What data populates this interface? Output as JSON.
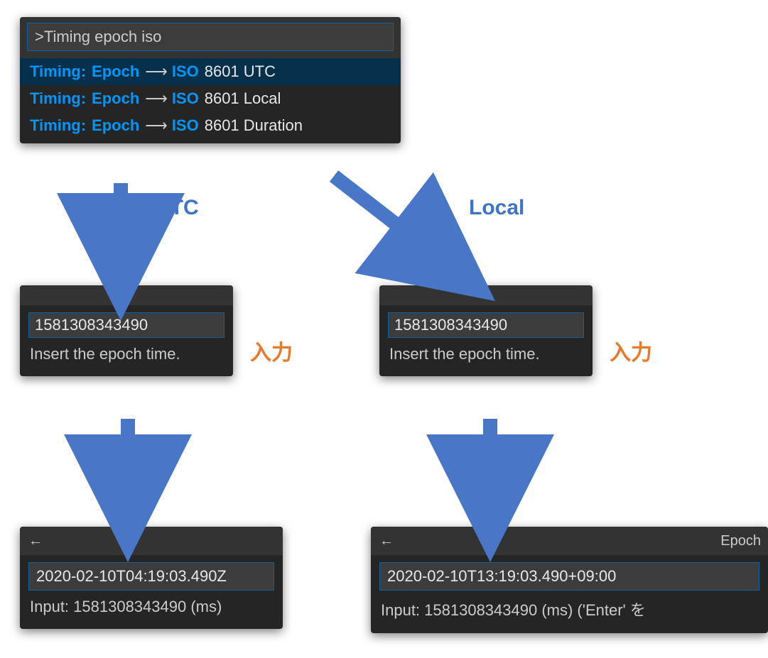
{
  "palette": {
    "input_value": ">Timing epoch iso",
    "items": [
      {
        "prefix": "Timing:",
        "mid": "Epoch",
        "arrow": "⟶",
        "iso": "ISO",
        "suffix": "8601 UTC",
        "selected": true
      },
      {
        "prefix": "Timing:",
        "mid": "Epoch",
        "arrow": "⟶",
        "iso": "ISO",
        "suffix": "8601 Local",
        "selected": false
      },
      {
        "prefix": "Timing:",
        "mid": "Epoch",
        "arrow": "⟶",
        "iso": "ISO",
        "suffix": "8601 Duration",
        "selected": false
      }
    ]
  },
  "flow_labels": {
    "utc": "UTC",
    "local": "Local",
    "input_jp": "入力"
  },
  "input_panels": {
    "utc": {
      "value": "1581308343490",
      "hint": "Insert the epoch time."
    },
    "local": {
      "value": "1581308343490",
      "hint": "Insert the epoch time."
    }
  },
  "result_panels": {
    "utc": {
      "back_icon": "←",
      "title": "",
      "value": "2020-02-10T04:19:03.490Z",
      "sub": "Input: 1581308343490 (ms)"
    },
    "local": {
      "back_icon": "←",
      "title": "Epoch",
      "value": "2020-02-10T13:19:03.490+09:00",
      "sub": "Input: 1581308343490 (ms) ('Enter' を"
    }
  }
}
